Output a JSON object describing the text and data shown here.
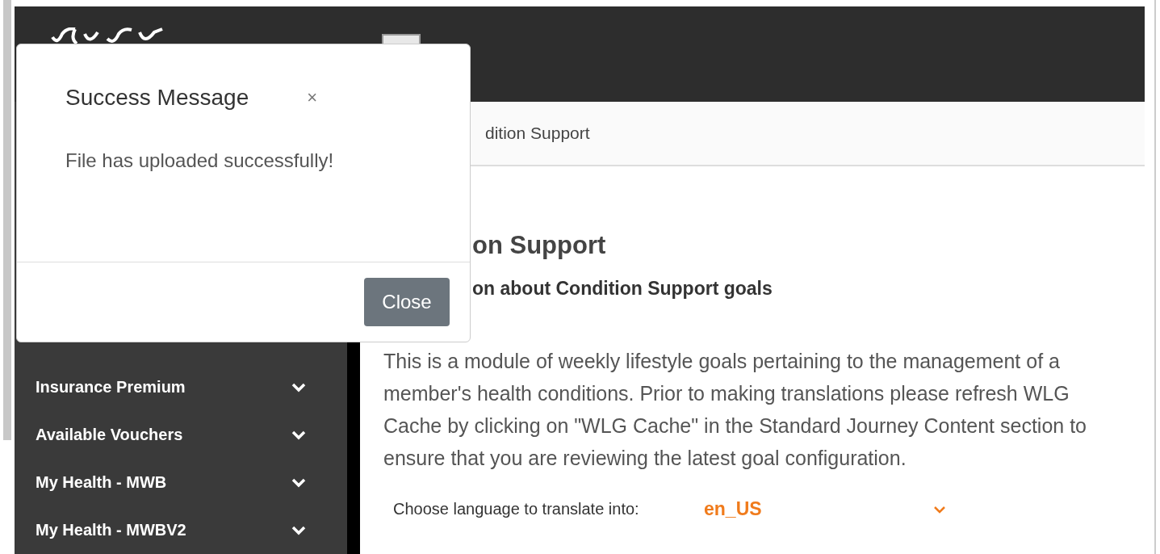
{
  "breadcrumb": {
    "text": "dition Support"
  },
  "sidebar": {
    "items": [
      {
        "label": "Insurance Premium",
        "expanded": false
      },
      {
        "label": "Available Vouchers",
        "expanded": false
      },
      {
        "label": "My Health - MWB",
        "expanded": false
      },
      {
        "label": "My Health - MWBV2",
        "expanded": false
      }
    ]
  },
  "content": {
    "title": "on Support",
    "subtitle": "on about Condition Support goals",
    "description": "This is a module of weekly lifestyle goals pertaining to the management of a member's health conditions. Prior to making translations please refresh WLG Cache by clicking on \"WLG Cache\" in the Standard Journey Content section to ensure that you are reviewing the latest goal configuration.",
    "language_label": "Choose language to translate into:",
    "language_value": "en_US"
  },
  "modal": {
    "title": "Success Message",
    "close_icon": "×",
    "body": "File has uploaded successfully!",
    "button": "Close"
  }
}
